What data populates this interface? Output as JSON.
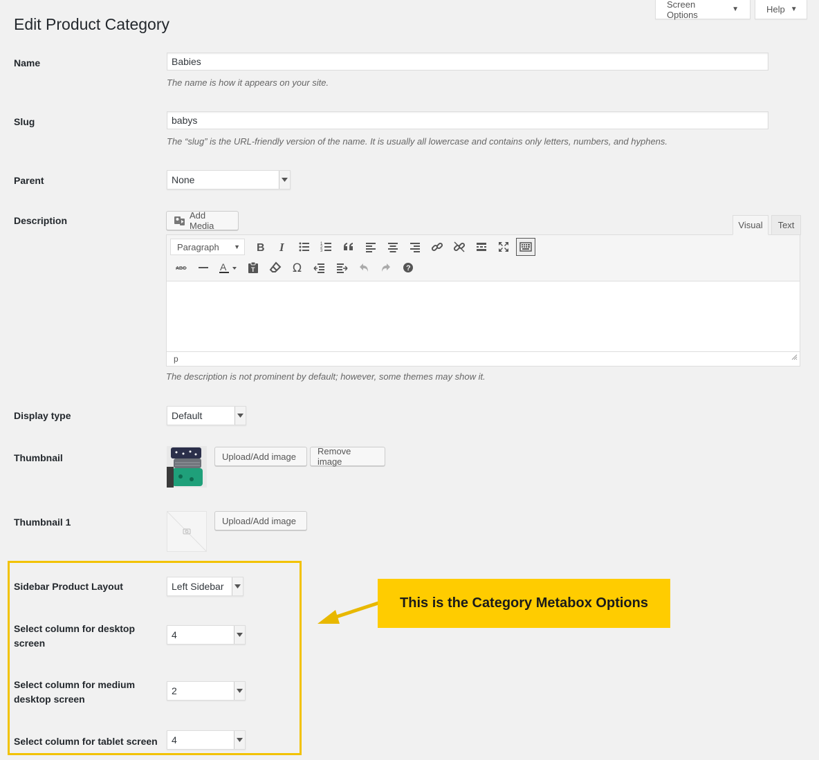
{
  "header": {
    "title": "Edit Product Category",
    "screen_options": "Screen Options",
    "help": "Help"
  },
  "fields": {
    "name": {
      "label": "Name",
      "value": "Babies",
      "description": "The name is how it appears on your site."
    },
    "slug": {
      "label": "Slug",
      "value": "babys",
      "description": "The “slug” is the URL-friendly version of the name. It is usually all lowercase and contains only letters, numbers, and hyphens."
    },
    "parent": {
      "label": "Parent",
      "value": "None"
    },
    "description": {
      "label": "Description",
      "add_media": "Add Media",
      "tab_visual": "Visual",
      "tab_text": "Text",
      "format_select": "Paragraph",
      "status_path": "p",
      "help": "The description is not prominent by default; however, some themes may show it."
    },
    "display_type": {
      "label": "Display type",
      "value": "Default"
    },
    "thumbnail": {
      "label": "Thumbnail",
      "upload": "Upload/Add image",
      "remove": "Remove image"
    },
    "thumbnail1": {
      "label": "Thumbnail 1",
      "upload": "Upload/Add image"
    }
  },
  "metabox": {
    "sidebar_layout": {
      "label": "Sidebar Product Layout",
      "value": "Left Sidebar"
    },
    "desktop_columns": {
      "label": "Select column for desktop screen",
      "value": "4"
    },
    "medium_columns": {
      "label": "Select column for medium desktop screen",
      "value": "2"
    },
    "tablet_columns": {
      "label": "Select column for tablet screen",
      "value": "4"
    }
  },
  "callout": {
    "text": "This is the Category Metabox Options"
  },
  "colors": {
    "highlight": "#f2c200",
    "callout_bg": "#ffcc00"
  }
}
